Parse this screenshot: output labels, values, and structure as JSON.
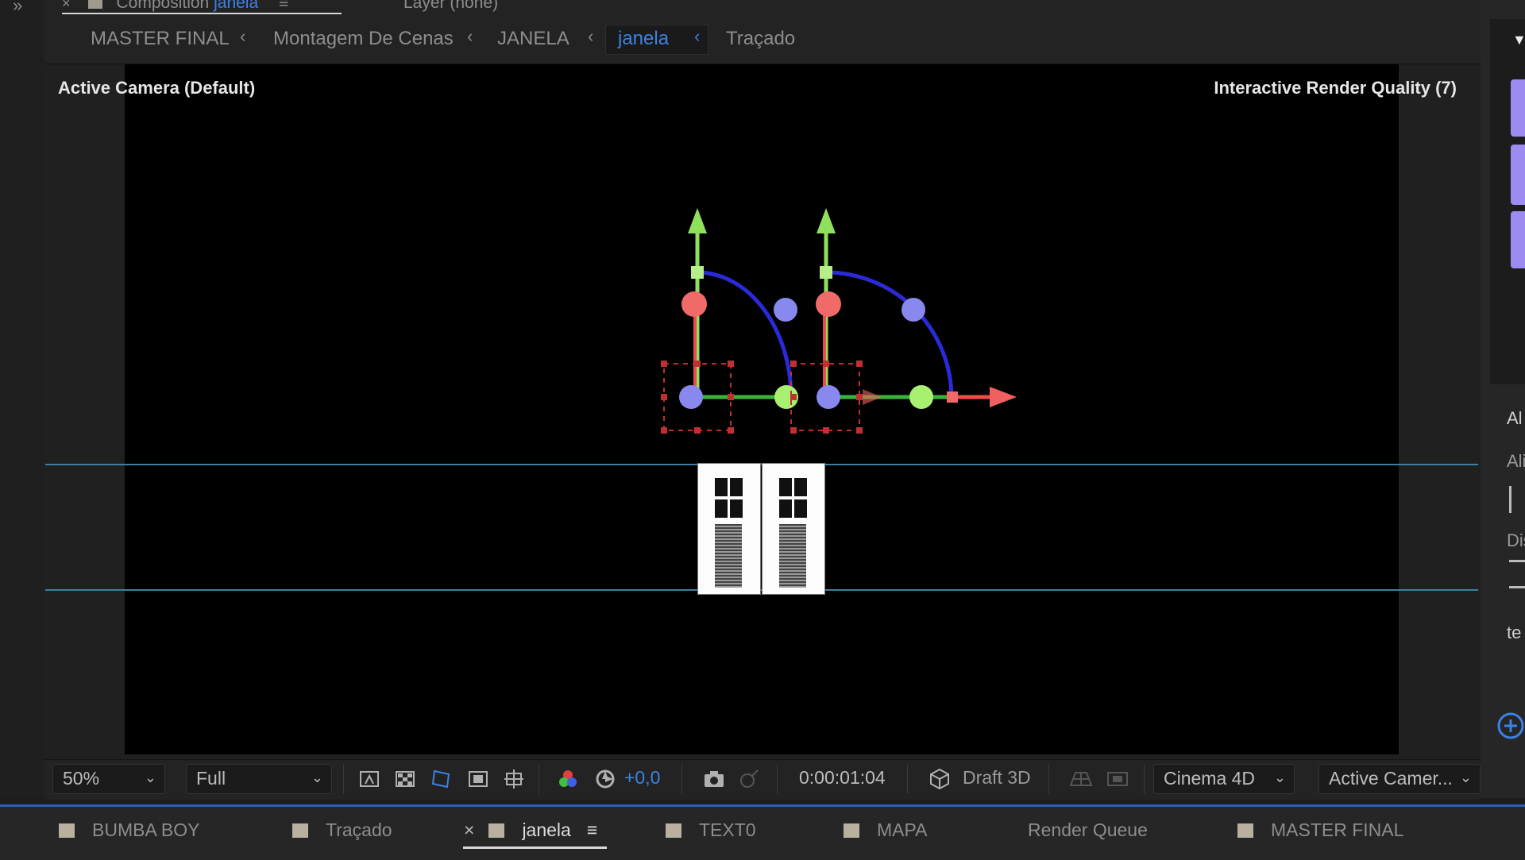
{
  "panel_header": {
    "comp_tab_prefix": "Composition",
    "comp_tab_name": "janela",
    "layer_tab": "Layer (none)"
  },
  "breadcrumb": [
    "MASTER FINAL",
    "Montagem De Cenas",
    "JANELA",
    "janela",
    "Traçado"
  ],
  "viewer": {
    "camera_label": "Active Camera (Default)",
    "render_quality_label": "Interactive Render Quality (7)"
  },
  "toolbar": {
    "zoom": "50%",
    "resolution": "Full",
    "exposure": "+0,0",
    "timecode": "0:00:01:04",
    "draft3d": "Draft 3D",
    "renderer": "Cinema 4D",
    "view": "Active Camer..."
  },
  "right_panel": {
    "align_title": "Al",
    "align_layers": "Alig",
    "distribute": "Dis",
    "text_title": "te"
  },
  "comp_tabs": [
    {
      "label": "BUMBA BOY",
      "swatch": "#b9b0a0"
    },
    {
      "label": "Traçado",
      "swatch": "#b9b0a0"
    },
    {
      "label": "janela",
      "swatch": "#b9b0a0",
      "active": true
    },
    {
      "label": "TEXT0",
      "swatch": "#b9b0a0"
    },
    {
      "label": "MAPA",
      "swatch": "#b9b0a0"
    },
    {
      "label": "Render Queue"
    },
    {
      "label": "MASTER FINAL",
      "swatch": "#b9b0a0"
    }
  ],
  "colors": {
    "accent_blue": "#3b82e6",
    "axis_x": "#f04a4a",
    "axis_y": "#8fe05a",
    "rotation_z": "#2a2ad8",
    "handle_blue": "#8888ee",
    "guide": "#3d7fa0"
  },
  "icons": [
    "grid-icon",
    "transparency-grid-icon",
    "mask-visibility-icon",
    "region-of-interest-icon",
    "guides-icon",
    "color-channels-icon",
    "reset-exposure-icon",
    "snapshot-camera-icon",
    "show-snapshot-icon",
    "draft3d-icon",
    "ground-plane-icon",
    "extended-viewer-icon"
  ]
}
